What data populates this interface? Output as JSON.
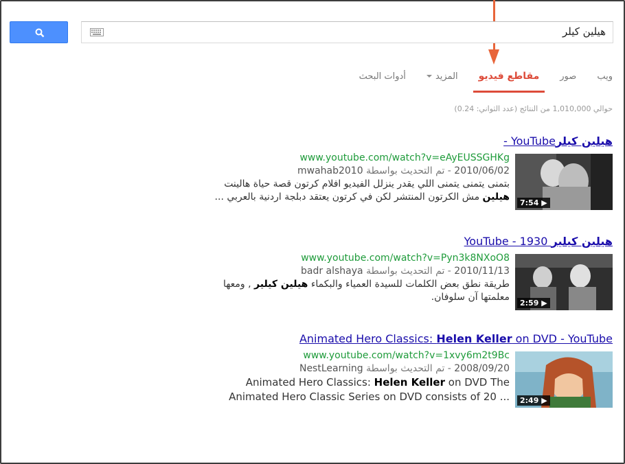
{
  "search": {
    "query": "هيلين كيلر"
  },
  "tabs": [
    {
      "label": "ويب",
      "active": false
    },
    {
      "label": "صور",
      "active": false
    },
    {
      "label": "مقاطع فيديو",
      "active": true
    },
    {
      "label": "المزيد",
      "active": false,
      "dropdown": true
    },
    {
      "label": "أدوات البحث",
      "active": false
    }
  ],
  "stats": "حوالي 1,010,000 من النتائج (عدد الثواني: 0.24)",
  "results": [
    {
      "title_bold": "هيلين كيلر",
      "title_rest": "YouTube -",
      "url": "www.youtube.com/watch?v=eAyEUSSGHKg",
      "date": "2010/06/02",
      "uploaded_by": "- تم التحديث بواسطة",
      "uploader": "mwahab2010",
      "desc_line1": "بتمنى يتمنى يتمنى اللي يقدر ينزلل الفيديو افلام كرتون قصة حياة هالينت",
      "desc_bold": "هيلين",
      "desc_line2": " مش الكرتون المنتشر لكن في كرتون يعتقد دبلجة اردنية بالعربي ...",
      "duration": "7:54 ▶"
    },
    {
      "title_bold": "هيلين كيلير",
      "title_rest": "YouTube - 1930",
      "url": "www.youtube.com/watch?v=Pyn3k8NXoO8",
      "date": "2010/11/13",
      "uploaded_by": "- تم التحديث بواسطة",
      "uploader": "badr alshaya",
      "desc_line1": "طريقة نطق بعض الكلمات للسيدة العمياء والبكماء ",
      "desc_bold": "هيلين كيلير",
      "desc_line2": " , ومعها معلمتها آن سلوفان.",
      "duration": "2:59 ▶"
    },
    {
      "title_pre": "Animated Hero Classics: ",
      "title_bold": "Helen Keller",
      "title_post": " on DVD - YouTube",
      "url": "www.youtube.com/watch?v=1xvy6m2t9Bc",
      "date": "2008/09/20",
      "uploaded_by": "- تم التحديث بواسطة",
      "uploader": "NestLearning",
      "desc_pre": "Animated Hero Classics: ",
      "desc_bold": "Helen Keller",
      "desc_post": " on DVD The Animated Hero Classic Series on DVD consists of 20 ...",
      "duration": "2:49 ▶"
    }
  ],
  "colors": {
    "accent_red": "#dd4b39",
    "link_blue": "#1a0dab",
    "url_green": "#1e9b3a",
    "button_blue": "#4d90fe",
    "annotation_arrow": "#e8653a"
  }
}
